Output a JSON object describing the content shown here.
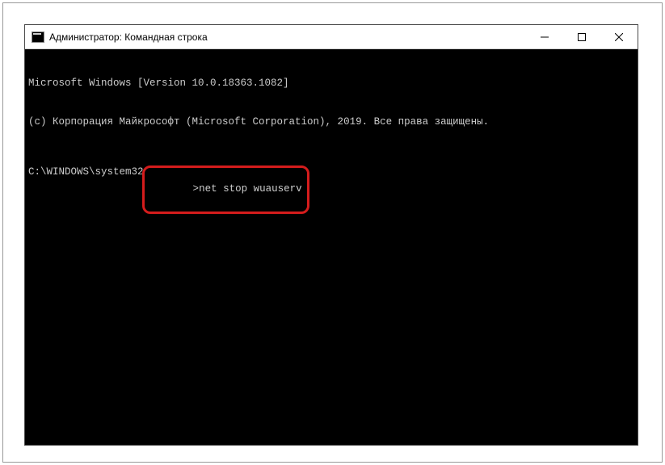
{
  "window": {
    "title": "Администратор: Командная строка"
  },
  "console": {
    "line1": "Microsoft Windows [Version 10.0.18363.1082]",
    "line2": "(c) Корпорация Майкрософт (Microsoft Corporation), 2019. Все права защищены.",
    "prompt": "C:\\WINDOWS\\system32",
    "caret": ">",
    "command": "net stop wuauserv"
  }
}
